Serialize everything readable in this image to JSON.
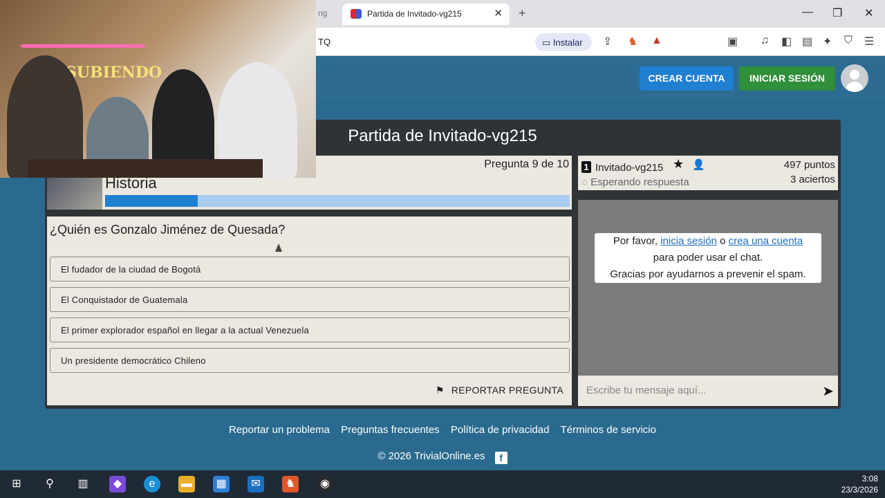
{
  "browser": {
    "prev_tab_fragment": "ng",
    "tab_title": "Partida de Invitado-vg215",
    "close_glyph": "✕",
    "newtab_glyph": "+",
    "url_fragment": "TQ",
    "install_label": "Instalar",
    "window_controls": [
      "—",
      "❐",
      "✕"
    ]
  },
  "header": {
    "create_account": "CREAR CUENTA",
    "login": "INICIAR SESIÓN"
  },
  "game": {
    "title": "Partida de Invitado-vg215",
    "question_counter": "Pregunta 9 de 10",
    "category": "Historia",
    "progress_fraction": 0.2,
    "question": "¿Quién es Gonzalo Jiménez de Quesada?",
    "answers": [
      "El fudador de la ciudad de Bogotá",
      "El Conquistador de Guatemala",
      "El primer explorador español en llegar a la actual Venezuela",
      "Un presidente democrático Chileno"
    ],
    "report_label": "REPORTAR PREGUNTA"
  },
  "player": {
    "rank": "1",
    "name": "Invitado-vg215",
    "status": "Esperando respuesta",
    "points": "497 puntos",
    "hits": "3 aciertos"
  },
  "chat": {
    "note_prefix": "Por favor,",
    "login_link": "inicia sesión",
    "or": "o",
    "create_link": "crea una cuenta",
    "note_line2": "para poder usar el chat.",
    "note_line3": "Gracias por ayudarnos a prevenir el spam.",
    "placeholder": "Escribe tu mensaje aquí..."
  },
  "footer": {
    "links": [
      "Reportar un problema",
      "Preguntas frecuentes",
      "Política de privacidad",
      "Términos de servicio"
    ],
    "copyright": "© 2026 TrivialOnline.es",
    "fb_glyph": "f"
  },
  "webcam": {
    "sign_text": "SUBIENDO"
  },
  "taskbar": {
    "time": "3:08",
    "date": "23/3/2026"
  }
}
